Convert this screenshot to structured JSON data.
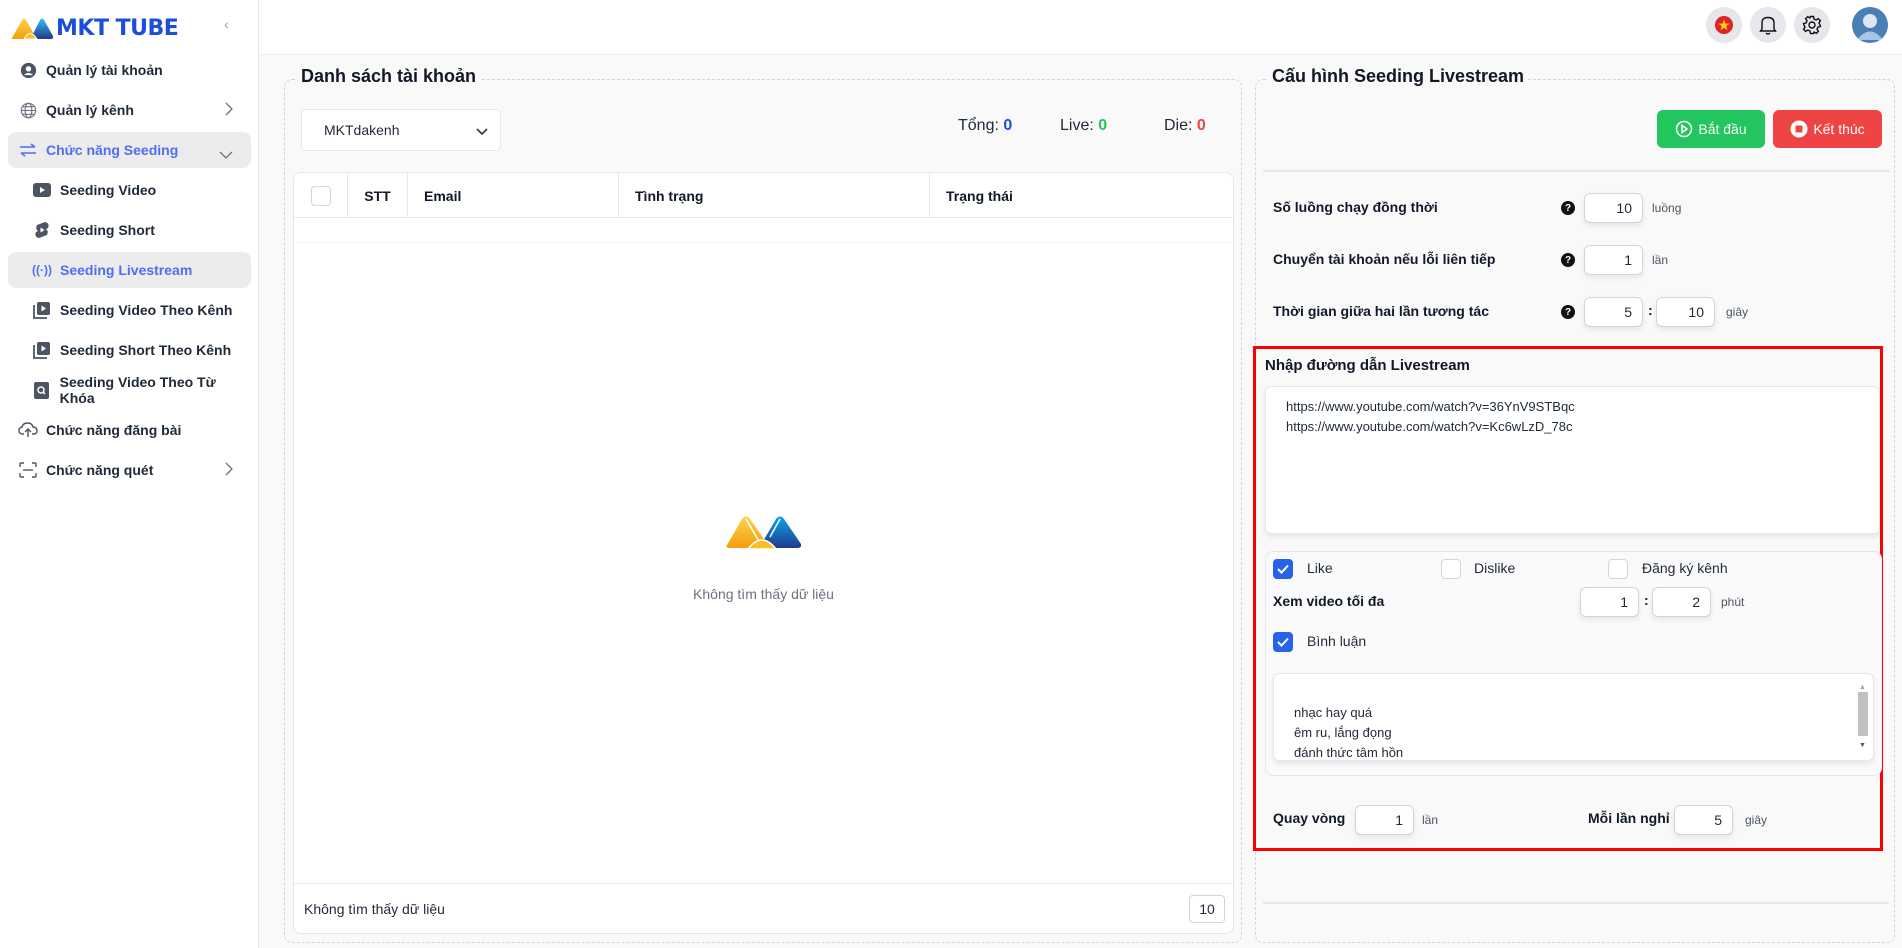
{
  "app": {
    "logo_text": "MKT TUBE"
  },
  "sidebar": {
    "collapse_icon": "chevron-left-icon",
    "items": [
      {
        "label": "Quản lý tài khoản",
        "icon": "user-circle-icon",
        "active": false,
        "sub": false
      },
      {
        "label": "Quản lý kênh",
        "icon": "globe-icon",
        "active": false,
        "sub": false,
        "chevron": "right"
      },
      {
        "label": "Chức năng Seeding",
        "icon": "swap-arrows-icon",
        "active": true,
        "sub": false,
        "chevron": "down"
      },
      {
        "label": "Seeding Video",
        "icon": "youtube-icon",
        "active": false,
        "sub": true
      },
      {
        "label": "Seeding Short",
        "icon": "shorts-icon",
        "active": false,
        "sub": true
      },
      {
        "label": "Seeding Livestream",
        "icon": "broadcast-icon",
        "active": true,
        "sub": true
      },
      {
        "label": "Seeding Video Theo Kênh",
        "icon": "video-library-icon",
        "active": false,
        "sub": true
      },
      {
        "label": "Seeding Short Theo Kênh",
        "icon": "video-library-icon",
        "active": false,
        "sub": true
      },
      {
        "label": "Seeding Video Theo Từ Khóa",
        "icon": "search-file-icon",
        "active": false,
        "sub": true
      },
      {
        "label": "Chức năng đăng bài",
        "icon": "cloud-upload-icon",
        "active": false,
        "sub": false
      },
      {
        "label": "Chức năng quét",
        "icon": "scan-icon",
        "active": false,
        "sub": false,
        "chevron": "right"
      }
    ]
  },
  "topbar": {
    "icons": [
      "vietnam-flag-icon",
      "bell-icon",
      "gear-icon",
      "avatar"
    ]
  },
  "accounts": {
    "title": "Danh sách tài khoản",
    "selected_folder": "MKTdakenh",
    "stats": {
      "total_label": "Tổng:",
      "total": "0",
      "live_label": "Live:",
      "live": "0",
      "die_label": "Die:",
      "die": "0"
    },
    "colors": {
      "total": "#1d4ed8",
      "live": "#22c55e",
      "die": "#ef4444"
    },
    "table": {
      "columns": [
        "STT",
        "Email",
        "Tình trạng",
        "Trạng thái"
      ],
      "rows": [],
      "empty_text": "Không tìm thấy dữ liệu"
    },
    "footer": {
      "text": "Không tìm thấy dữ liệu",
      "page_size": "10"
    }
  },
  "config": {
    "title": "Cấu hình Seeding Livestream",
    "start_label": "Bắt đầu",
    "stop_label": "Kết thúc",
    "threads": {
      "label": "Số luồng chạy đồng thời",
      "value": "10",
      "unit": "luồng"
    },
    "switch_on_error": {
      "label": "Chuyển tài khoản nếu lỗi liên tiếp",
      "value": "1",
      "unit": "lần"
    },
    "interval": {
      "label": "Thời gian giữa hai lần tương tác",
      "min": "5",
      "max": "10",
      "unit": "giây"
    },
    "links": {
      "label": "Nhập đường dẫn Livestream",
      "value": "https://www.youtube.com/watch?v=36YnV9STBqc\nhttps://www.youtube.com/watch?v=Kc6wLzD_78c"
    },
    "like": {
      "label": "Like",
      "checked": true
    },
    "dislike": {
      "label": "Dislike",
      "checked": false
    },
    "subscribe": {
      "label": "Đăng ký kênh",
      "checked": false
    },
    "watch": {
      "label": "Xem video tối đa",
      "min": "1",
      "max": "2",
      "unit": "phút"
    },
    "comment": {
      "label": "Bình luận",
      "checked": true,
      "value": "nhạc hay quá\nêm ru, lắng đọng\nđánh thức tâm hồn\nyêu đời thông qua bài hát"
    },
    "loop": {
      "label": "Quay vòng",
      "value": "1",
      "unit": "lần"
    },
    "rest": {
      "label": "Mỗi lần nghỉ",
      "value": "5",
      "unit": "giây"
    }
  }
}
